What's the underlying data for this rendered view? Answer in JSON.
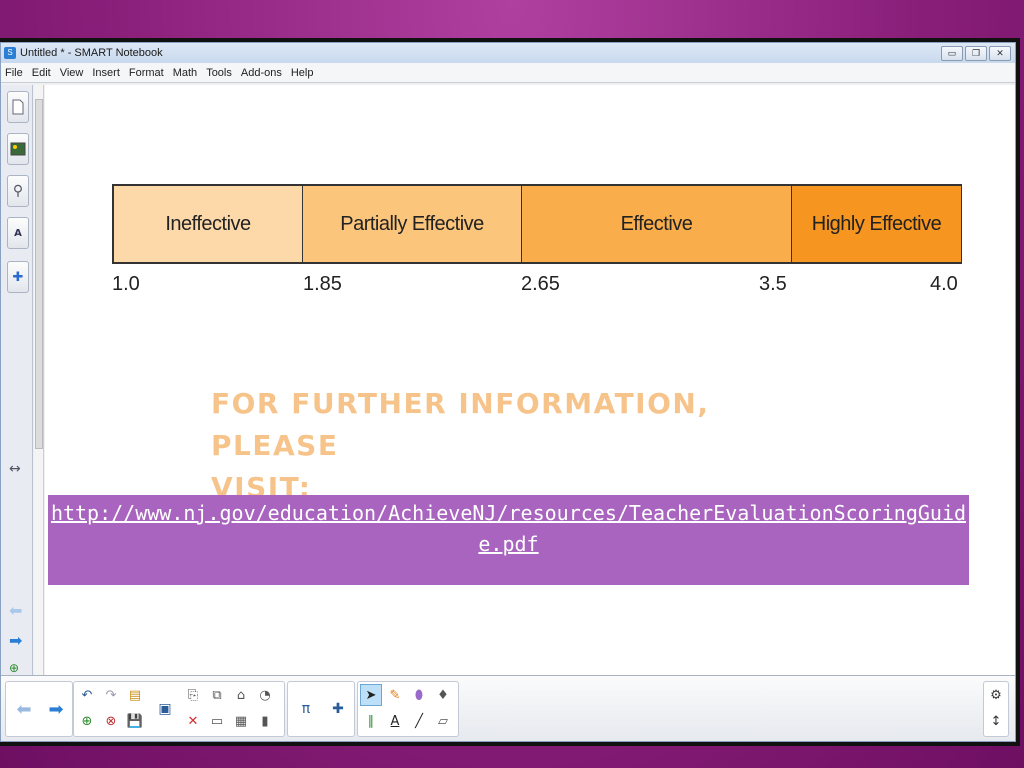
{
  "window": {
    "title": "Untitled * - SMART Notebook",
    "app_icon": "smart-notebook-icon",
    "minimize": "▭",
    "restore": "🗗",
    "close": "✕"
  },
  "menu": [
    "File",
    "Edit",
    "View",
    "Insert",
    "Format",
    "Math",
    "Tools",
    "Add-ons",
    "Help"
  ],
  "scale": {
    "segments": [
      {
        "label": "Ineffective",
        "color": "#fdd9aa"
      },
      {
        "label": "Partially Effective",
        "color": "#fbc57c"
      },
      {
        "label": "Effective",
        "color": "#f9ae4b"
      },
      {
        "label": "Highly Effective",
        "color": "#f6951f"
      }
    ],
    "ticks": [
      "1.0",
      "1.85",
      "2.65",
      "3.5",
      "4.0"
    ]
  },
  "info": {
    "heading_line1": "FOR FURTHER INFORMATION, PLEASE",
    "heading_line2": "VISIT:",
    "link": "http://www.nj.gov/education/AchieveNJ/resources/TeacherEvaluationScoringGuide.pdf"
  },
  "colors": {
    "heading": "#f6c48a",
    "link_box": "#a864be",
    "background": "#8a1f7a"
  }
}
